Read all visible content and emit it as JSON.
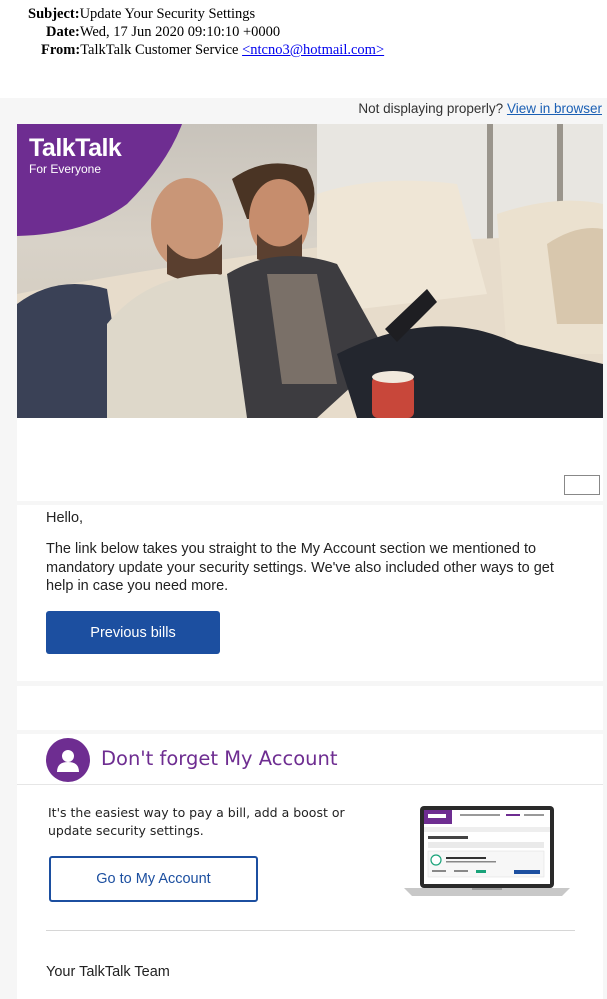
{
  "email_header": {
    "subject_label": "Subject:",
    "subject": "Update Your Security Settings",
    "date_label": "Date:",
    "date": "Wed, 17 Jun 2020 09:10:10 +0000",
    "from_label": "From:",
    "from_name": "TalkTalk Customer Service",
    "from_email": "<ntcno3@hotmail.com>"
  },
  "preheader": {
    "text": "Not displaying properly?",
    "link": "View in browser"
  },
  "hero": {
    "brand_name": "TalkTalk",
    "brand_tagline": "For Everyone",
    "brand_color": "#6e2d91"
  },
  "body": {
    "greeting": "Hello,",
    "paragraph": "The link below takes you straight to the My Account section we mentioned to mandatory update your security settings. We've also included other ways to get help in case you need more.",
    "button_label": "Previous bills"
  },
  "my_account": {
    "title": "Don't forget My Account",
    "description": "It's the easiest way to pay a bill, add a boost or update security settings.",
    "button_label": "Go to My Account",
    "avatar_icon": "user-icon"
  },
  "footer": {
    "signoff": "Your TalkTalk Team"
  },
  "colors": {
    "accent_purple": "#6e2d91",
    "button_blue": "#1c4fa0",
    "link_blue": "#1a5fb4"
  }
}
